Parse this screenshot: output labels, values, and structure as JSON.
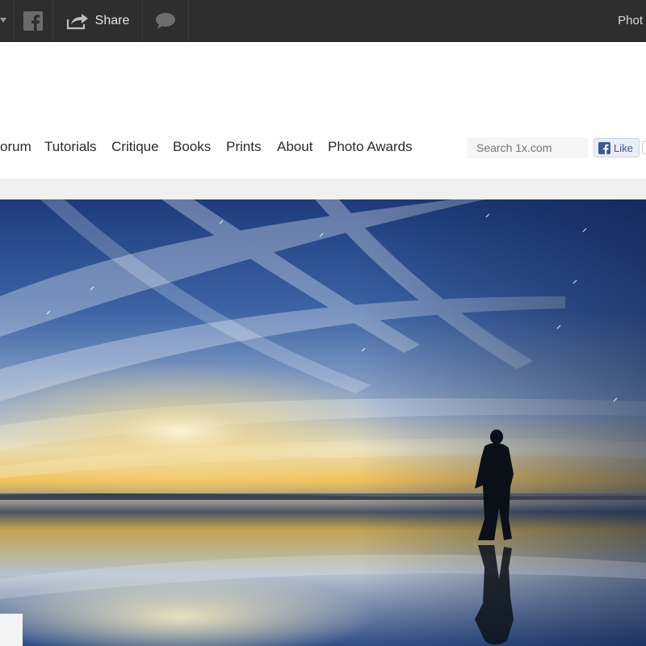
{
  "topbar": {
    "share_label": "Share",
    "right_label": "Phot",
    "icons": [
      "dropdown-caret-icon",
      "facebook-icon",
      "share-arrow-icon",
      "speech-bubble-icon"
    ]
  },
  "nav": {
    "items": [
      {
        "label": "orum"
      },
      {
        "label": "Tutorials"
      },
      {
        "label": "Critique"
      },
      {
        "label": "Books"
      },
      {
        "label": "Prints"
      },
      {
        "label": "About"
      },
      {
        "label": "Photo Awards"
      }
    ]
  },
  "search": {
    "placeholder": "Search 1x.com"
  },
  "like": {
    "label": "Like"
  },
  "colors": {
    "topbar": "#2e2e2e",
    "facebook_blue": "#3b5998",
    "sky_deep": "#1f3f82",
    "sun_gold": "#f2c454"
  }
}
